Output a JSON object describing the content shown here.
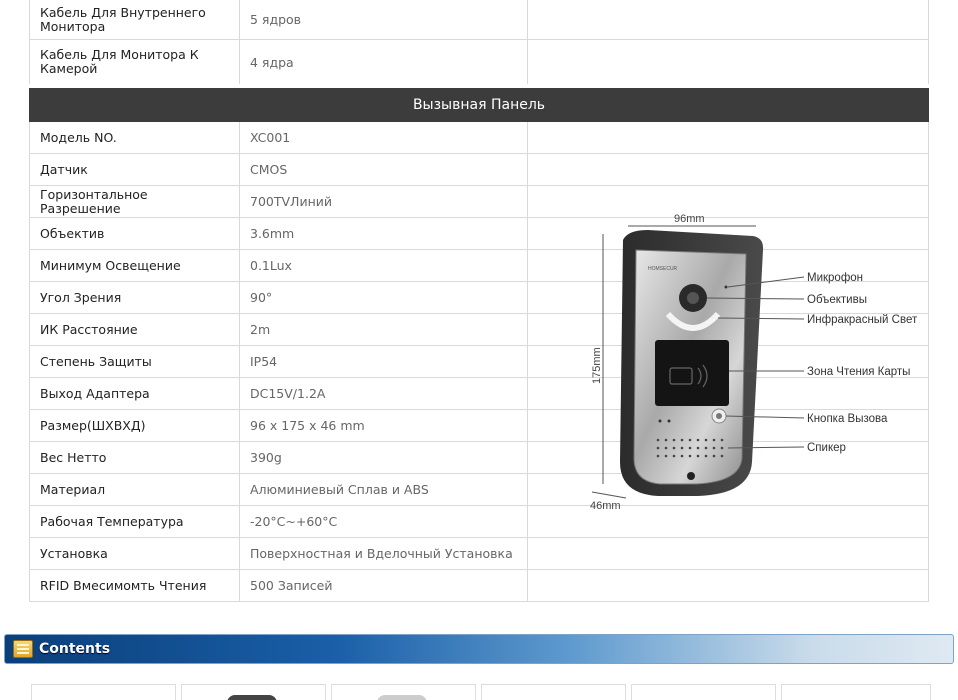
{
  "top_rows": [
    {
      "key": "Кабель Для Внутреннего Монитора",
      "value": "5 ядров"
    },
    {
      "key": "Кабель Для Монитора К Камерой",
      "value": "4 ядра"
    }
  ],
  "section_title": "Вызывная Панель",
  "spec_rows": [
    {
      "key": "Модель NO.",
      "value": "XC001"
    },
    {
      "key": "Датчик",
      "value": "CMOS"
    },
    {
      "key": "Горизонтальное Разрешение",
      "value": "700TVЛиний"
    },
    {
      "key": "Объектив",
      "value": "3.6mm"
    },
    {
      "key": "Минимум Освещение",
      "value": "0.1Lux"
    },
    {
      "key": "Угол Зрения",
      "value": "90°"
    },
    {
      "key": "ИК Расстояние",
      "value": "2m"
    },
    {
      "key": "Степень Защиты",
      "value": "IP54"
    },
    {
      "key": "Выход Адаптера",
      "value": "DC15V/1.2A"
    },
    {
      "key": "Размер(ШХВХД)",
      "value": "96 x 175 x 46 mm"
    },
    {
      "key": "Вес Нетто",
      "value": "390g"
    },
    {
      "key": "Материал",
      "value": "Алюминиевый Сплав и ABS"
    },
    {
      "key": "Рабочая Температура",
      "value": "-20°C~+60°C"
    },
    {
      "key": "Установка",
      "value": "Поверхностная и Вделочный Установка"
    },
    {
      "key": "RFID Вмесимомть Чтения",
      "value": "500 Записей"
    }
  ],
  "diagram": {
    "width_label": "96mm",
    "height_label": "175mm",
    "depth_label": "46mm",
    "brand": "HOMSECUR",
    "callouts": [
      "Микрофон",
      "Объективы",
      "Инфракрасный Свет",
      "Зона Чтения Карты",
      "Кнопка Вызова",
      "Спикер"
    ]
  },
  "contents_label": "Contents",
  "colors": {
    "section_bg": "#3c3c3c",
    "contents_bar_start": "#0a3f7a",
    "contents_bar_end": "#dfe9f2"
  }
}
